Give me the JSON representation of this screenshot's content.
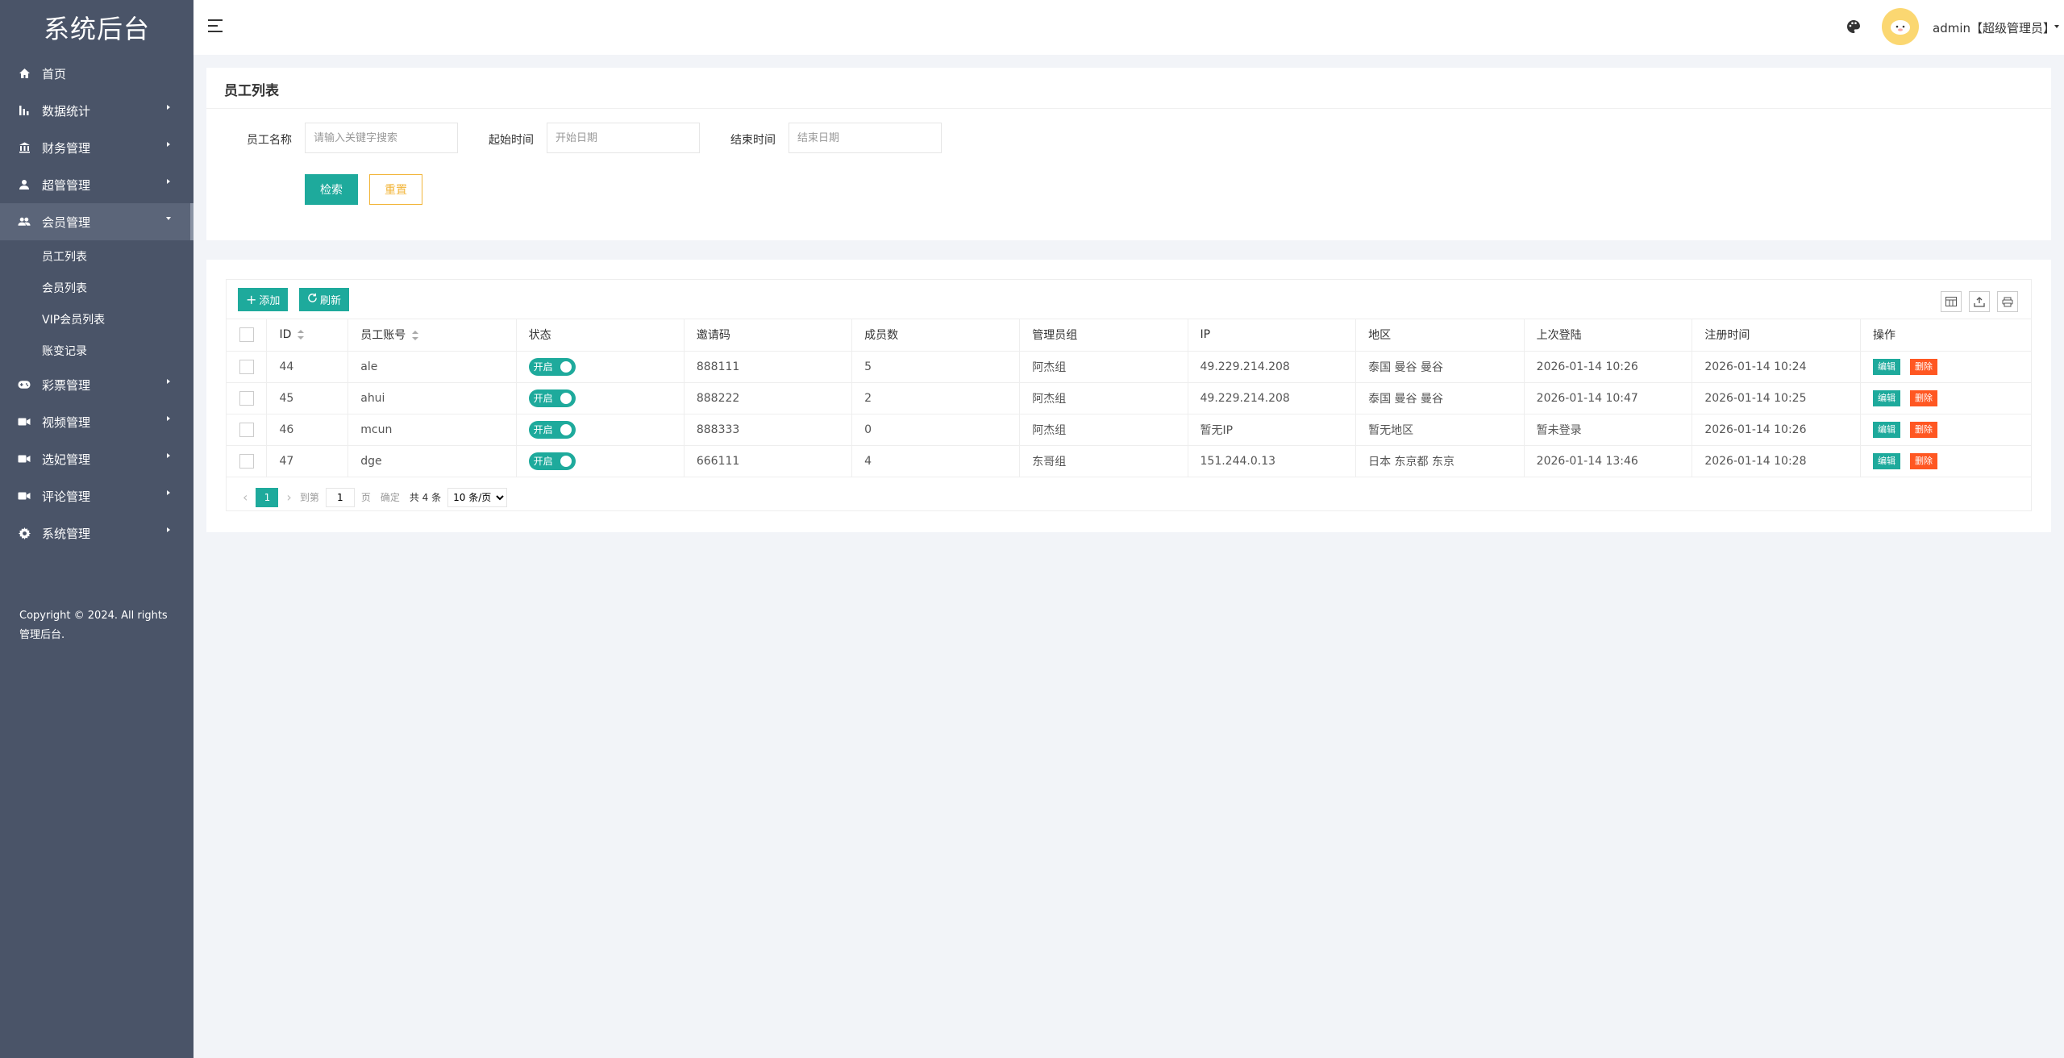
{
  "app": {
    "title": "系统后台"
  },
  "sidebar": {
    "items": [
      {
        "label": "首页",
        "icon": "home-icon"
      },
      {
        "label": "数据统计",
        "icon": "bar-chart-icon"
      },
      {
        "label": "财务管理",
        "icon": "bank-icon"
      },
      {
        "label": "超管管理",
        "icon": "user-icon"
      },
      {
        "label": "会员管理",
        "icon": "users-icon",
        "open": true,
        "children": [
          "员工列表",
          "会员列表",
          "VIP会员列表",
          "账变记录"
        ]
      },
      {
        "label": "彩票管理",
        "icon": "gamepad-icon"
      },
      {
        "label": "视频管理",
        "icon": "video-icon"
      },
      {
        "label": "选妃管理",
        "icon": "video-icon"
      },
      {
        "label": "评论管理",
        "icon": "video-icon"
      },
      {
        "label": "系统管理",
        "icon": "gear-icon"
      }
    ],
    "copyright": "Copyright © 2024. All rights 管理后台."
  },
  "header": {
    "user": "admin【超级管理员】",
    "accent": "#1eaa9c"
  },
  "search": {
    "title": "员工列表",
    "name_label": "员工名称",
    "name_placeholder": "请输入关键字搜索",
    "start_label": "起始时间",
    "start_placeholder": "开始日期",
    "end_label": "结束时间",
    "end_placeholder": "结束日期",
    "search_button": "检索",
    "reset_button": "重置"
  },
  "toolbar": {
    "add": "添加",
    "refresh": "刷新"
  },
  "table": {
    "columns": [
      "ID",
      "员工账号",
      "状态",
      "邀请码",
      "成员数",
      "管理员组",
      "IP",
      "地区",
      "上次登陆",
      "注册时间",
      "操作"
    ],
    "rows": [
      {
        "id": "44",
        "account": "ale",
        "status": "开启",
        "invite": "888111",
        "members": "5",
        "group": "阿杰组",
        "ip": "49.229.214.208",
        "region": "泰国 曼谷 曼谷",
        "last_login": "2026-01-14 10:26",
        "registered": "2026-01-14 10:24"
      },
      {
        "id": "45",
        "account": "ahui",
        "status": "开启",
        "invite": "888222",
        "members": "2",
        "group": "阿杰组",
        "ip": "49.229.214.208",
        "region": "泰国 曼谷 曼谷",
        "last_login": "2026-01-14 10:47",
        "registered": "2026-01-14 10:25"
      },
      {
        "id": "46",
        "account": "mcun",
        "status": "开启",
        "invite": "888333",
        "members": "0",
        "group": "阿杰组",
        "ip": "暂无IP",
        "region": "暂无地区",
        "last_login": "暂未登录",
        "registered": "2026-01-14 10:26"
      },
      {
        "id": "47",
        "account": "dge",
        "status": "开启",
        "invite": "666111",
        "members": "4",
        "group": "东哥组",
        "ip": "151.244.0.13",
        "region": "日本 东京都 东京",
        "last_login": "2026-01-14 13:46",
        "registered": "2026-01-14 10:28"
      }
    ],
    "edit_label": "编辑",
    "delete_label": "删除"
  },
  "pager": {
    "current": "1",
    "goto_label": "到第",
    "goto_value": "1",
    "page_unit": "页",
    "confirm": "确定",
    "total": "共 4 条",
    "page_size": "10 条/页"
  }
}
